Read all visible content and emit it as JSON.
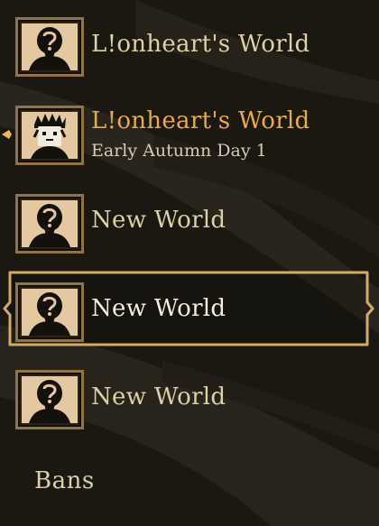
{
  "worlds": [
    {
      "name": "L!onheart's World",
      "detail": "",
      "portrait": "unknown-character-icon",
      "state": "normal"
    },
    {
      "name": "L!onheart's World",
      "detail": "Early Autumn Day 1",
      "portrait": "wilson-character-icon",
      "state": "active"
    },
    {
      "name": "New World",
      "detail": "",
      "portrait": "unknown-character-icon",
      "state": "normal"
    },
    {
      "name": "New World",
      "detail": "",
      "portrait": "unknown-character-icon",
      "state": "selected"
    },
    {
      "name": "New World",
      "detail": "",
      "portrait": "unknown-character-icon",
      "state": "normal"
    }
  ],
  "bans_label": "Bans",
  "colors": {
    "background": "#1b1812",
    "title_text": "#ddcfa6",
    "active_title": "#eea93a",
    "selected_title": "#f3eee2",
    "frame_gold": "#c9a55a"
  }
}
